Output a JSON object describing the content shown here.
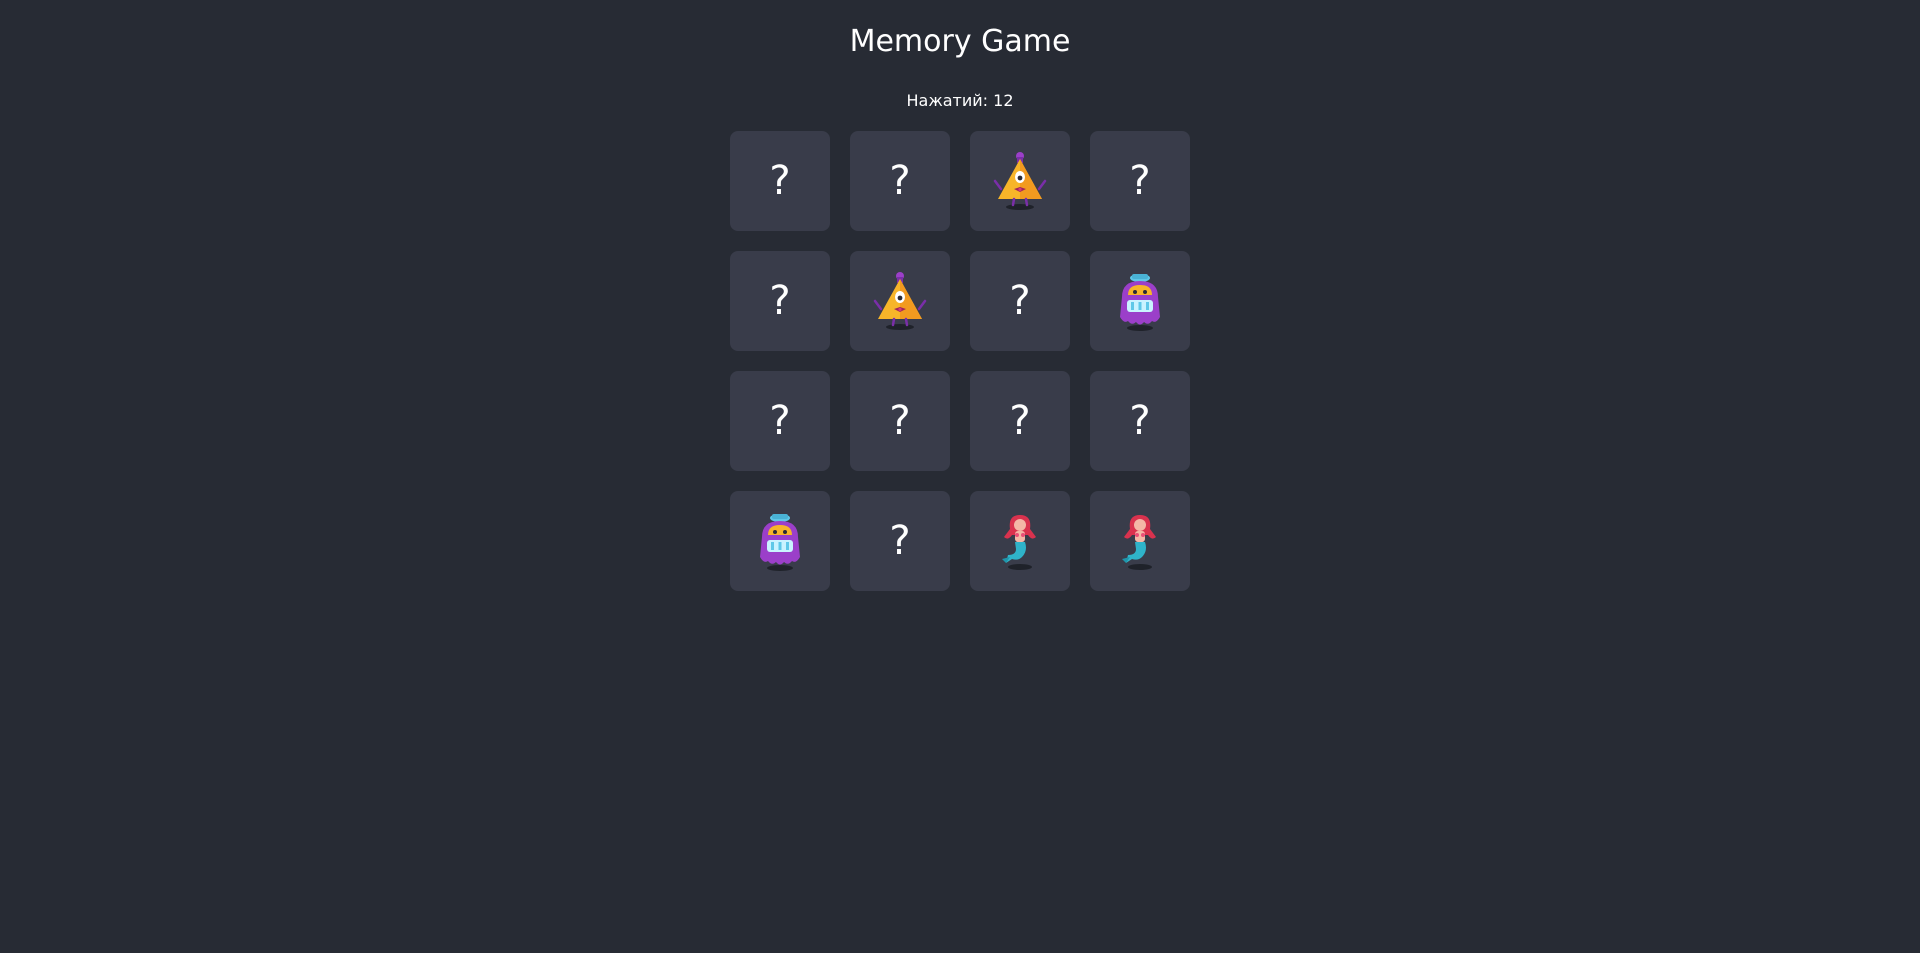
{
  "header": {
    "title": "Memory Game",
    "counter_label": "Нажатий: 12"
  },
  "board": {
    "hidden_symbol": "?",
    "cards": [
      {
        "state": "hidden",
        "icon": "question-mark"
      },
      {
        "state": "hidden",
        "icon": "question-mark"
      },
      {
        "state": "revealed",
        "icon": "triangle-eye-creature-icon"
      },
      {
        "state": "hidden",
        "icon": "question-mark"
      },
      {
        "state": "hidden",
        "icon": "question-mark"
      },
      {
        "state": "revealed",
        "icon": "triangle-eye-creature-icon"
      },
      {
        "state": "hidden",
        "icon": "question-mark"
      },
      {
        "state": "revealed",
        "icon": "purple-monster-icon"
      },
      {
        "state": "hidden",
        "icon": "question-mark"
      },
      {
        "state": "hidden",
        "icon": "question-mark"
      },
      {
        "state": "hidden",
        "icon": "question-mark"
      },
      {
        "state": "hidden",
        "icon": "question-mark"
      },
      {
        "state": "revealed",
        "icon": "purple-monster-icon"
      },
      {
        "state": "hidden",
        "icon": "question-mark"
      },
      {
        "state": "revealed",
        "icon": "mermaid-icon"
      },
      {
        "state": "revealed",
        "icon": "mermaid-icon"
      }
    ]
  },
  "colors": {
    "background": "#272b34",
    "card": "#393c4a",
    "text": "#ffffff"
  }
}
